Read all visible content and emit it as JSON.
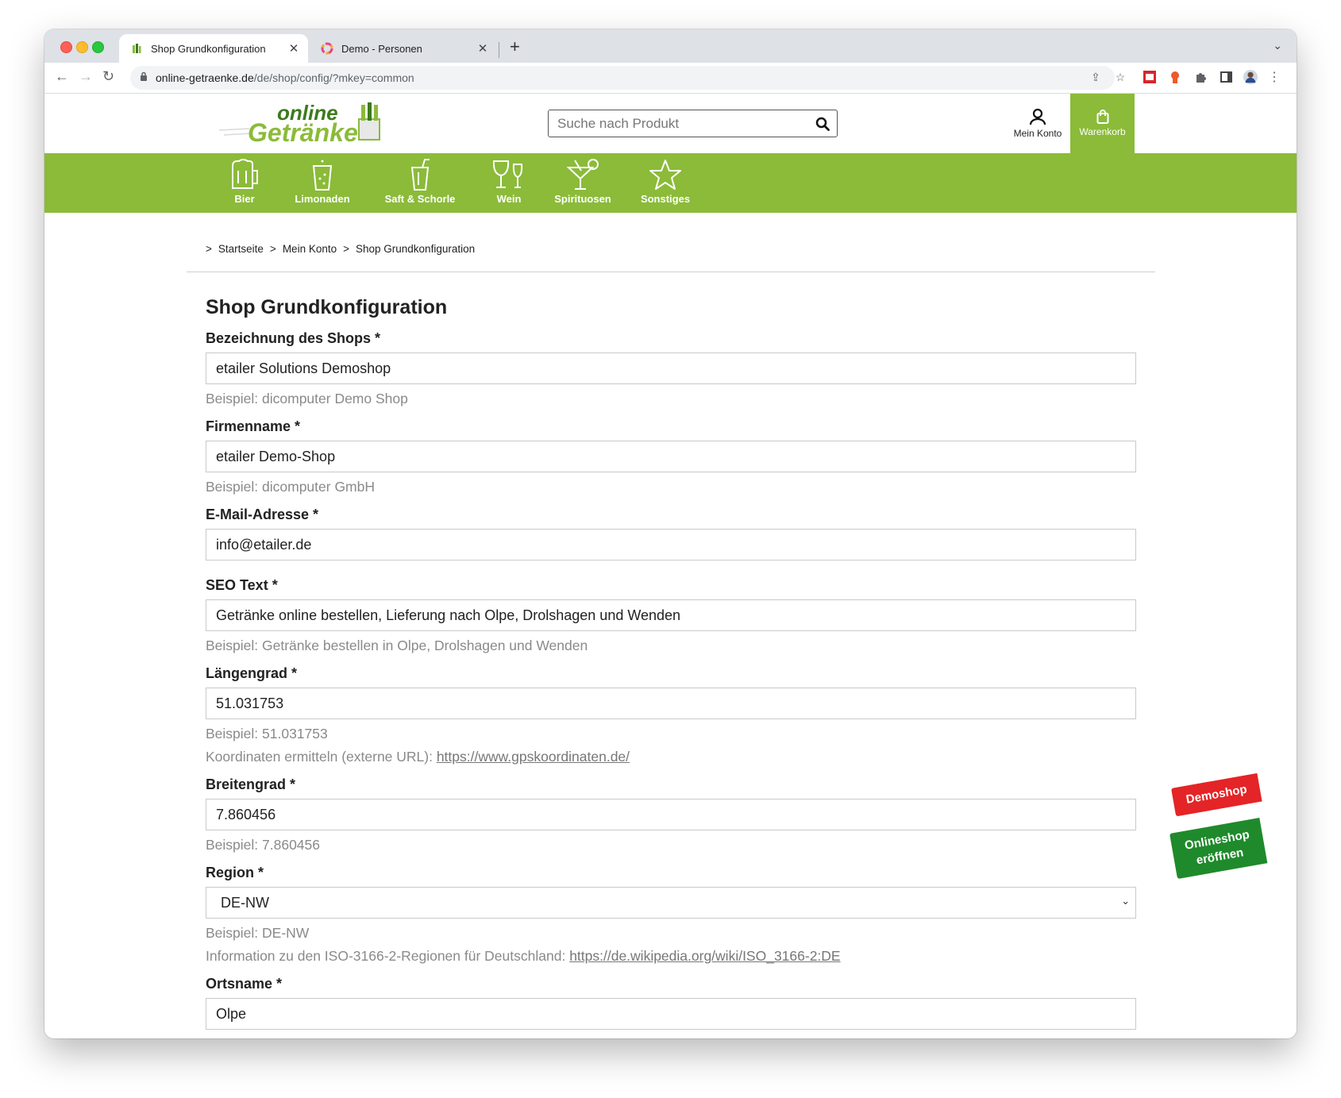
{
  "browser": {
    "tabs": [
      {
        "title": "Shop Grundkonfiguration",
        "active": true
      },
      {
        "title": "Demo - Personen",
        "active": false
      }
    ],
    "url_host": "online-getraenke.de",
    "url_path": "/de/shop/config/?mkey=common"
  },
  "header": {
    "search_placeholder": "Suche nach Produkt",
    "account_label": "Mein Konto",
    "cart_label": "Warenkorb",
    "brand_color": "#8bbb39"
  },
  "categories": [
    "Bier",
    "Limonaden",
    "Saft & Schorle",
    "Wein",
    "Spirituosen",
    "Sonstiges"
  ],
  "breadcrumb": [
    ">",
    "Startseite",
    ">",
    "Mein Konto",
    ">",
    "Shop Grundkonfiguration"
  ],
  "form": {
    "title": "Shop Grundkonfiguration",
    "fields": {
      "shop_name": {
        "label": "Bezeichnung des Shops *",
        "value": "etailer Solutions Demoshop",
        "hint": "Beispiel: dicomputer Demo Shop"
      },
      "company": {
        "label": "Firmenname *",
        "value": "etailer Demo-Shop",
        "hint": "Beispiel: dicomputer GmbH"
      },
      "email": {
        "label": "E-Mail-Adresse *",
        "value": "info@etailer.de"
      },
      "seo": {
        "label": "SEO Text *",
        "value": "Getränke online bestellen, Lieferung nach Olpe, Drolshagen und Wenden",
        "hint": "Beispiel: Getränke bestellen in Olpe, Drolshagen und Wenden"
      },
      "longitude": {
        "label": "Längengrad *",
        "value": "51.031753",
        "hint": "Beispiel: 51.031753",
        "info_text": "Koordinaten ermitteln (externe URL): ",
        "info_link": "https://www.gpskoordinaten.de/"
      },
      "latitude": {
        "label": "Breitengrad *",
        "value": "7.860456",
        "hint": "Beispiel: 7.860456"
      },
      "region": {
        "label": "Region *",
        "value": "DE-NW",
        "hint": "Beispiel: DE-NW",
        "info_text": "Information zu den ISO-3166-2-Regionen für Deutschland: ",
        "info_link": "https://de.wikipedia.org/wiki/ISO_3166-2:DE"
      },
      "city": {
        "label": "Ortsname *",
        "value": "Olpe"
      }
    }
  },
  "badges": {
    "demoshop": "Demoshop",
    "open_line1": "Onlineshop",
    "open_line2": "eröffnen"
  }
}
